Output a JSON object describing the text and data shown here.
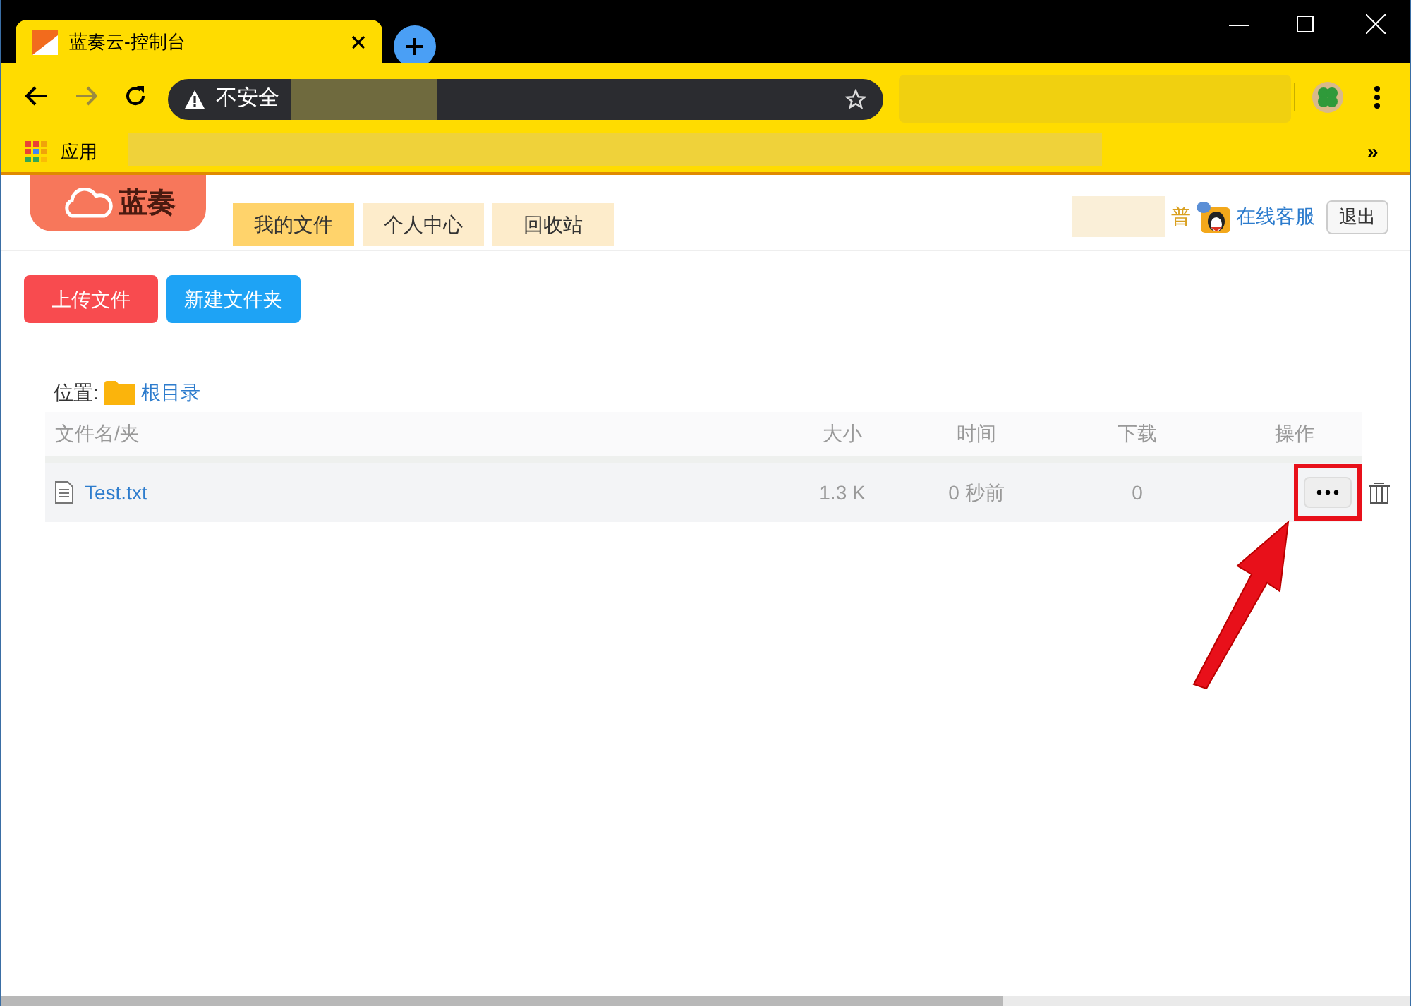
{
  "window": {
    "tab_title": "蓝奏云-控制台"
  },
  "address_bar": {
    "security_label": "不安全"
  },
  "bookmarks": {
    "items": [
      {
        "label": "应用"
      }
    ],
    "overflow": "»"
  },
  "site": {
    "logo_text": "蓝奏",
    "nav_tabs": [
      {
        "label": "我的文件",
        "selected": true
      },
      {
        "label": "个人中心",
        "selected": false
      },
      {
        "label": "回收站",
        "selected": false
      }
    ],
    "user_suffix": "普",
    "support_link": "在线客服",
    "logout_button": "退出"
  },
  "actions": [
    {
      "label": "上传文件",
      "kind": "danger"
    },
    {
      "label": "新建文件夹",
      "kind": "primary"
    }
  ],
  "breadcrumb": {
    "label": "位置:",
    "folder": "根目录"
  },
  "table": {
    "columns": [
      "文件名/夹",
      "大小",
      "时间",
      "下载",
      "操作"
    ],
    "rows": [
      {
        "name": "Test.txt",
        "size": "1.3 K",
        "time": "0 秒前",
        "downloads": "0",
        "highlighted": true
      }
    ]
  }
}
